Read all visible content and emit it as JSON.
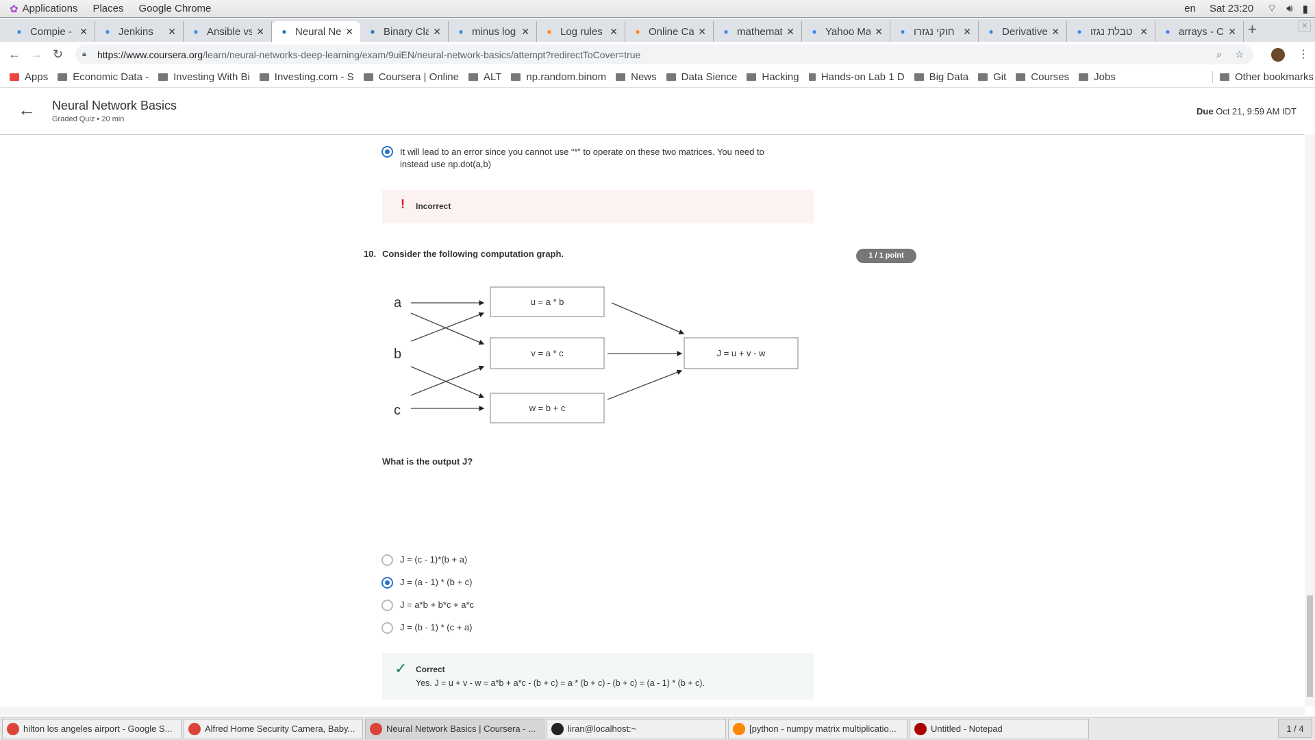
{
  "system": {
    "menus": [
      "Applications",
      "Places",
      "Google Chrome"
    ],
    "lang": "en",
    "clock": "Sat 23:20"
  },
  "tabs": [
    {
      "label": "Compie - G",
      "icon": "google-icon",
      "active": false
    },
    {
      "label": "Jenkins",
      "icon": "jenkins-icon",
      "active": false
    },
    {
      "label": "Ansible vs",
      "icon": "page-icon",
      "active": false
    },
    {
      "label": "Neural Ne",
      "icon": "coursera-icon",
      "active": true
    },
    {
      "label": "Binary Cla",
      "icon": "coursera-icon",
      "active": false
    },
    {
      "label": "minus log",
      "icon": "google-icon",
      "active": false
    },
    {
      "label": "Log rules",
      "icon": "r-icon",
      "active": false
    },
    {
      "label": "Online Ca",
      "icon": "r-icon",
      "active": false
    },
    {
      "label": "mathemat",
      "icon": "bookmark-icon",
      "active": false
    },
    {
      "label": "Yahoo Ma",
      "icon": "yahoo-icon",
      "active": false
    },
    {
      "label": "חוקי נגזרו",
      "icon": "google-icon",
      "active": false
    },
    {
      "label": "Derivative",
      "icon": "derivative-icon",
      "active": false
    },
    {
      "label": "טבלת נגזו",
      "icon": "site-icon",
      "active": false
    },
    {
      "label": "arrays - C",
      "icon": "stackoverflow-icon",
      "active": false
    }
  ],
  "url": {
    "domain": "https://www.coursera.org",
    "path": "/learn/neural-networks-deep-learning/exam/9uiEN/neural-network-basics/attempt?redirectToCover=true"
  },
  "bookmarks": [
    "Apps",
    "Economic Data -",
    "Investing With Bi",
    "Investing.com - S",
    "Coursera | Online",
    "ALT",
    "np.random.binom",
    "News",
    "Data Sience",
    "Hacking",
    "Hands-on Lab 1 D",
    "Big Data",
    "Git",
    "Courses",
    "Jobs"
  ],
  "other_bookmarks": "Other bookmarks",
  "header": {
    "title": "Neural Network Basics",
    "subtitle": "Graded Quiz • 20 min",
    "due_label": "Due",
    "due_value": "Oct 21, 9:59 AM IDT"
  },
  "prev": {
    "answer": "It will lead to an error since you cannot use “*” to operate on these two matrices. You need to instead use np.dot(a,b)",
    "feedback": "Incorrect"
  },
  "q10": {
    "number": "10.",
    "prompt": "Consider the following computation graph.",
    "points": "1 / 1 point",
    "graph": {
      "inputs": [
        "a",
        "b",
        "c"
      ],
      "nodes": [
        "u = a * b",
        "v = a * c",
        "w = b + c"
      ],
      "output": "J = u + v - w"
    },
    "question": "What is the output J?",
    "options": [
      {
        "label": "J = (c - 1)*(b + a)",
        "selected": false
      },
      {
        "label": "J = (a - 1) * (b + c)",
        "selected": true
      },
      {
        "label": "J = a*b + b*c + a*c",
        "selected": false
      },
      {
        "label": "J = (b - 1) * (c + a)",
        "selected": false
      }
    ],
    "feedback_title": "Correct",
    "feedback_text": "Yes. J = u + v - w = a*b + a*c - (b + c) = a * (b + c) - (b + c) = (a - 1) * (b + c)."
  },
  "taskbar": [
    {
      "label": "hilton los angeles airport - Google S...",
      "active": false
    },
    {
      "label": "Alfred Home Security Camera, Baby...",
      "active": false
    },
    {
      "label": "Neural Network Basics | Coursera - ...",
      "active": true
    },
    {
      "label": "liran@localhost:~",
      "active": false
    },
    {
      "label": "[python - numpy matrix multiplicatio...",
      "active": false
    },
    {
      "label": "Untitled - Notepad",
      "active": false
    }
  ],
  "workspace": "1 / 4",
  "colors": {
    "accent": "#2a73cc",
    "incorrect_bg": "#fdf2f2",
    "correct_bg": "#f3f8f6",
    "badge": "#777777"
  }
}
